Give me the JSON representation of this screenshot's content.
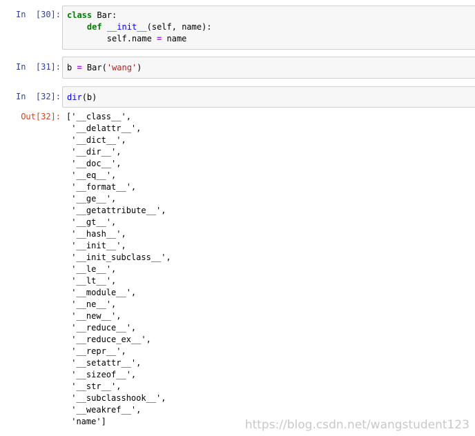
{
  "cells": [
    {
      "prompt": "In  [30]:",
      "line1": {
        "kw": "class",
        "rest": " Bar:"
      },
      "line2": {
        "indent": "    ",
        "kw": "def",
        "space": " ",
        "fn": "__init__",
        "rest": "(self, name):"
      },
      "line3": {
        "indent": "        ",
        "pre": "self.name ",
        "op": "=",
        "post": " name"
      }
    },
    {
      "prompt": "In  [31]:",
      "line1": {
        "pre": "b ",
        "op": "=",
        "mid": " Bar(",
        "str": "'wang'",
        "post": ")"
      }
    },
    {
      "prompt": "In  [32]:",
      "line1": {
        "fn": "dir",
        "rest": "(b)"
      }
    }
  ],
  "output": {
    "prompt": "Out[32]:",
    "lines": [
      "['__class__',",
      " '__delattr__',",
      " '__dict__',",
      " '__dir__',",
      " '__doc__',",
      " '__eq__',",
      " '__format__',",
      " '__ge__',",
      " '__getattribute__',",
      " '__gt__',",
      " '__hash__',",
      " '__init__',",
      " '__init_subclass__',",
      " '__le__',",
      " '__lt__',",
      " '__module__',",
      " '__ne__',",
      " '__new__',",
      " '__reduce__',",
      " '__reduce_ex__',",
      " '__repr__',",
      " '__setattr__',",
      " '__sizeof__',",
      " '__str__',",
      " '__subclasshook__',",
      " '__weakref__',",
      " 'name']"
    ]
  },
  "watermark": "https://blog.csdn.net/wangstudent123",
  "colors": {
    "prompt_in": "#303f9f",
    "prompt_out": "#d84315",
    "keyword": "#008000",
    "function": "#0000ff",
    "operator": "#aa22ff",
    "string": "#ba2121"
  }
}
